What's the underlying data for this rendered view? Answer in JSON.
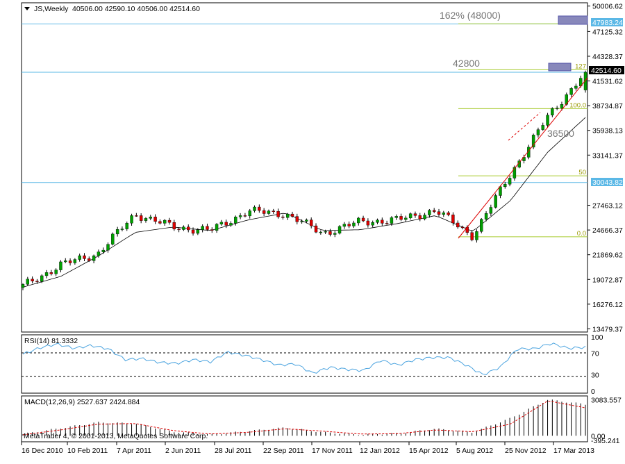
{
  "colors": {
    "background": "#ffffff",
    "frame": "#000000",
    "bull_body": "#00a000",
    "bear_body": "#dd0000",
    "wick": "#000000",
    "ma_line": "#000000",
    "hline": "#5bb8e6",
    "fib_line": "#aacc33",
    "trend_line": "#dd0000",
    "rsi_line": "#4aa3df",
    "macd_signal": "#dd0000",
    "price_tag": "#000000",
    "level_tag": "#5bb8e6",
    "target_box": "#8888bb",
    "annotation_text": "#777777"
  },
  "header": {
    "symbol_label": "JS,Weekly",
    "ohlc_text": "40506.00 42590.10 40506.00 42514.60"
  },
  "rsi_label": "RSI(14) 81.3332",
  "macd_label": "MACD(12,26,9) 2527.637 2424.884",
  "copyright": "MetaTrader 4, © 2001-2013, MetaQuotes Software Corp.",
  "annotations": {
    "target_162": "162% (48000)",
    "level_42800": "42800",
    "level_36500": "36500"
  },
  "fib_labels": [
    "161.8",
    "127",
    "100.0",
    "50",
    "0.0"
  ],
  "price_tags": {
    "level_top": "47983.24",
    "current": "42514.60",
    "level_mid": "30043.82"
  },
  "chart_data": [
    {
      "type": "candlestick",
      "title": "JS,Weekly",
      "ohlc_last": {
        "open": 40506.0,
        "high": 42590.1,
        "low": 40506.0,
        "close": 42514.6
      },
      "ylim": [
        13200,
        50300
      ],
      "y_ticks": [
        "50006.62",
        "47125.32",
        "44328.37",
        "41531.62",
        "38734.87",
        "35938.13",
        "33141.37",
        "27463.12",
        "24666.37",
        "21869.62",
        "19072.87",
        "16276.12",
        "13479.37"
      ],
      "x_ticks": [
        "16 Dec 2010",
        "10 Feb 2011",
        "7 Apr 2011",
        "2 Jun 2011",
        "28 Jul 2011",
        "22 Sep 2011",
        "17 Nov 2011",
        "12 Jan 2012",
        "15 Apr 2012",
        "5 Aug 2012",
        "25 Nov 2012",
        "17 Mar 2013"
      ],
      "moving_average_trend": [
        18200,
        19400,
        21700,
        24400,
        25000,
        24600,
        25800,
        26600,
        24600,
        24700,
        25400,
        26300,
        24500,
        28000,
        33500,
        37400
      ],
      "close_trend": [
        18300,
        20700,
        22000,
        26500,
        25000,
        24600,
        26800,
        26500,
        24300,
        25600,
        25800,
        26900,
        24000,
        31000,
        37500,
        42514.6
      ],
      "horizontal_levels": [
        47983.24,
        42514.6,
        30043.82
      ],
      "fibonacci_levels": [
        {
          "label": "161.8",
          "value": 48000
        },
        {
          "label": "127",
          "value": 42800
        },
        {
          "label": "100.0",
          "value": 38400
        },
        {
          "label": "50",
          "value": 30800
        },
        {
          "label": "0.0",
          "value": 23900
        }
      ],
      "annotations": [
        "162% (48000)",
        "42800",
        "36500"
      ]
    },
    {
      "type": "line",
      "title": "RSI(14) 81.3332",
      "ylim": [
        0,
        100
      ],
      "y_ticks": [
        "100",
        "70",
        "30",
        "0"
      ],
      "levels": [
        70,
        30
      ],
      "values": [
        68,
        80,
        87,
        79,
        84,
        78,
        58,
        60,
        53,
        51,
        58,
        54,
        72,
        66,
        58,
        48,
        50,
        33,
        44,
        40,
        38,
        57,
        48,
        58,
        62,
        62,
        48,
        30,
        44,
        78,
        78,
        88,
        79,
        81
      ]
    },
    {
      "type": "bar",
      "title": "MACD(12,26,9) 2527.637 2424.884",
      "y_ticks": [
        "3083.557",
        "0.00",
        "-395.241"
      ],
      "ylim": [
        -395.241,
        3300
      ],
      "histogram_trend": [
        150,
        650,
        1150,
        1050,
        350,
        100,
        400,
        700,
        300,
        100,
        200,
        600,
        300,
        1500,
        3100,
        2700
      ],
      "signal_trend": [
        80,
        500,
        1000,
        1050,
        450,
        150,
        300,
        600,
        400,
        150,
        180,
        500,
        350,
        1000,
        3000,
        2400
      ]
    }
  ]
}
